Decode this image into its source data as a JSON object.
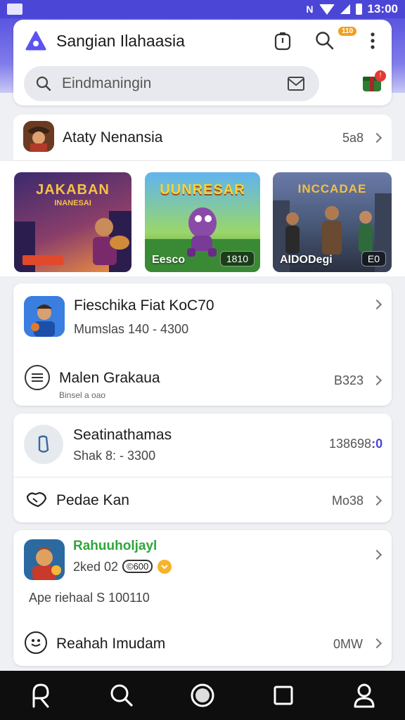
{
  "status_bar": {
    "time": "13:00",
    "nfc": "N"
  },
  "header": {
    "title": "Sangian Ilahaasia",
    "search_placeholder": "Eindmaningin",
    "notification_badge": "110"
  },
  "featured": {
    "title": "Ataty Nenansia",
    "value": "5a8",
    "thumbnails": [
      {
        "title": "JAKABAN",
        "subtitle": "INANESAI",
        "label": "",
        "pill": ""
      },
      {
        "title": "UUNRESAR",
        "subtitle": "",
        "label": "Eesco",
        "pill": "1810"
      },
      {
        "title": "INCCADAE",
        "subtitle": "",
        "label": "AIDODegi",
        "pill": "E0"
      }
    ]
  },
  "card1": {
    "item1_title": "Fieschika Fiat KoC70",
    "item1_sub": "Mumslas 140 - 4300",
    "item2_title": "Malen Grakaua",
    "item2_sub": "Binsel a oao",
    "item2_value": "B323"
  },
  "card2": {
    "item1_title": "Seatinathamas",
    "item1_sub": "Shak 8: - 3300",
    "item1_value": "138698",
    "item1_value_accent": ":0",
    "item2_title": "Pedae Kan",
    "item2_value": "Mo38"
  },
  "card3": {
    "user_name": "Rahuuholjayl",
    "user_meta": "2ked 02",
    "user_tag": "©600",
    "description": "Ape riehaal S 100110",
    "item_title": "Reahah Imudam",
    "item_value": "0MW"
  },
  "colors": {
    "primary": "#4b46d6",
    "green_name": "#2fa63a",
    "accent_value": "#4b46d6",
    "badge": "#f0a020"
  }
}
